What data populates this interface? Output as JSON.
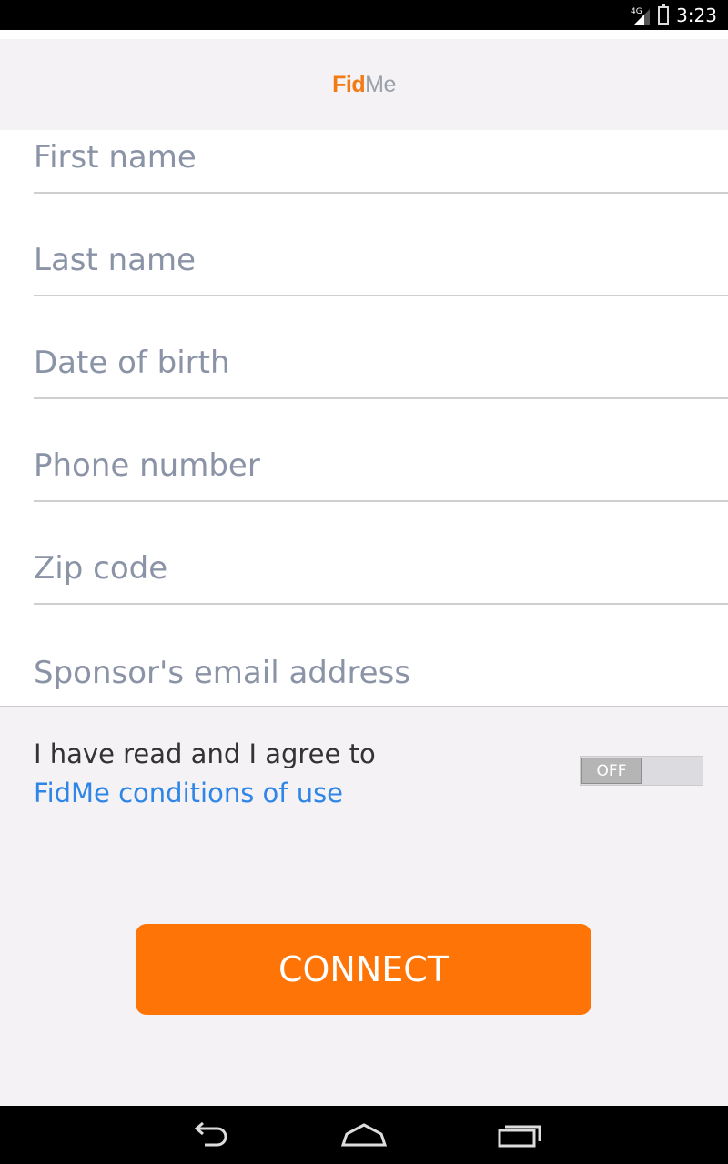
{
  "status_bar": {
    "network": "4G",
    "time": "3:23",
    "icons": [
      "signal-icon",
      "battery-icon"
    ]
  },
  "app_bar": {
    "logo_bold": "Fid",
    "logo_light": "Me"
  },
  "form": {
    "fields": [
      {
        "placeholder": "First name",
        "value": ""
      },
      {
        "placeholder": "Last name",
        "value": ""
      },
      {
        "placeholder": "Date of birth",
        "value": ""
      },
      {
        "placeholder": "Phone number",
        "value": ""
      },
      {
        "placeholder": "Zip code",
        "value": ""
      },
      {
        "placeholder": "Sponsor's email address",
        "value": ""
      }
    ]
  },
  "agreement": {
    "text": "I have read and I agree to",
    "link": "FidMe conditions of use",
    "toggle_state": "OFF"
  },
  "connect_button": "CONNECT",
  "navigation": {
    "icons": [
      "back-icon",
      "home-icon",
      "recent-apps-icon"
    ]
  },
  "colors": {
    "accent": "#ff7406",
    "link": "#2f86e6",
    "logo_orange": "#f47a14"
  }
}
